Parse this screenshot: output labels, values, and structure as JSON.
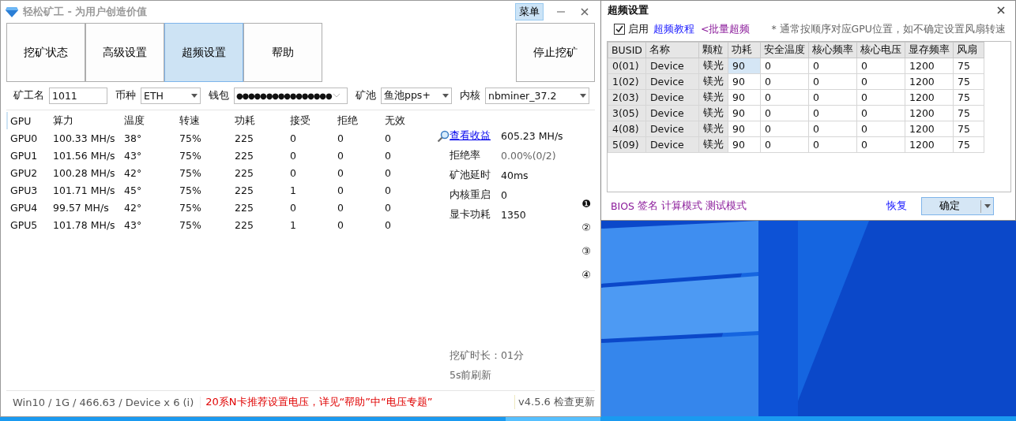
{
  "main_window": {
    "title": "轻松矿工 - 为用户创造价值",
    "menu_button": "菜单",
    "nav_tabs": [
      {
        "label": "挖矿状态",
        "selected": false
      },
      {
        "label": "高级设置",
        "selected": false
      },
      {
        "label": "超频设置",
        "selected": true
      },
      {
        "label": "帮助",
        "selected": false
      }
    ],
    "stop_button": "停止挖矿",
    "fields": [
      {
        "label": "矿工名",
        "value": "1011",
        "kind": "text"
      },
      {
        "label": "币种",
        "value": "ETH",
        "kind": "dropdown"
      },
      {
        "label": "钱包",
        "value": "●●●●●●●●●●●●●●●●",
        "kind": "password"
      },
      {
        "label": "矿池",
        "value": "鱼池pps+",
        "kind": "dropdown"
      },
      {
        "label": "内核",
        "value": "nbminer_37.2",
        "kind": "dropdown"
      }
    ],
    "gpu_table": {
      "columns": [
        "GPU",
        "算力",
        "温度",
        "转速",
        "功耗",
        "接受",
        "拒绝",
        "无效"
      ],
      "rows": [
        [
          "GPU0",
          "100.33 MH/s",
          "38°",
          "75%",
          "225",
          "0",
          "0",
          "0"
        ],
        [
          "GPU1",
          "101.56 MH/s",
          "43°",
          "75%",
          "225",
          "0",
          "0",
          "0"
        ],
        [
          "GPU2",
          "100.28 MH/s",
          "42°",
          "75%",
          "225",
          "0",
          "0",
          "0"
        ],
        [
          "GPU3",
          "101.71 MH/s",
          "45°",
          "75%",
          "225",
          "1",
          "0",
          "0"
        ],
        [
          "GPU4",
          "99.57 MH/s",
          "42°",
          "75%",
          "225",
          "0",
          "0",
          "0"
        ],
        [
          "GPU5",
          "101.78 MH/s",
          "43°",
          "75%",
          "225",
          "1",
          "0",
          "0"
        ]
      ]
    },
    "stats": [
      {
        "label": "查看收益",
        "value": "605.23 MH/s",
        "kind": "link"
      },
      {
        "label": "拒绝率",
        "value": "0.00%(0/2)",
        "kind": "muted"
      },
      {
        "label": "矿池延时",
        "value": "40ms",
        "kind": "plain"
      },
      {
        "label": "内核重启",
        "value": "0",
        "kind": "plain"
      },
      {
        "label": "显卡功耗",
        "value": "1350",
        "kind": "plain"
      }
    ],
    "pages": [
      "❶",
      "②",
      "③",
      "④"
    ],
    "runtime": {
      "label": "挖矿时长：",
      "value": "01分"
    },
    "refresh": "5s前刷新",
    "status_bar": {
      "system": "Win10  / 1G / 466.63 / Device x 6 (i)",
      "notice": "20系N卡推荐设置电压，详见“帮助”中“电压专题”",
      "version": "v4.5.6 检查更新"
    }
  },
  "overclock_window": {
    "title": "超频设置",
    "enable": {
      "label": "启用",
      "checked": true
    },
    "links": [
      {
        "label": "超频教程",
        "kind": "tutorial"
      },
      {
        "label": "<批量超频",
        "kind": "batch"
      }
    ],
    "note": "* 通常按顺序对应GPU位置，如不确定设置风扇转速",
    "table": {
      "columns": [
        "BUSID",
        "名称",
        "颗粒",
        "功耗",
        "安全温度",
        "核心频率",
        "核心电压",
        "显存频率",
        "风扇"
      ],
      "rows": [
        {
          "cells": [
            {
              "text": "0(01)",
              "selected": false
            },
            {
              "text": "Device",
              "selected": false
            },
            {
              "text": "镁光",
              "selected": false
            },
            {
              "text": "90",
              "selected": true
            },
            {
              "text": "0",
              "selected": false
            },
            {
              "text": "0",
              "selected": false
            },
            {
              "text": "0",
              "selected": false
            },
            {
              "text": "1200",
              "selected": false
            },
            {
              "text": "75",
              "selected": false
            }
          ]
        },
        {
          "cells": [
            {
              "text": "1(02)",
              "selected": false
            },
            {
              "text": "Device",
              "selected": false
            },
            {
              "text": "镁光",
              "selected": false
            },
            {
              "text": "90",
              "selected": false
            },
            {
              "text": "0",
              "selected": false
            },
            {
              "text": "0",
              "selected": false
            },
            {
              "text": "0",
              "selected": false
            },
            {
              "text": "1200",
              "selected": false
            },
            {
              "text": "75",
              "selected": false
            }
          ]
        },
        {
          "cells": [
            {
              "text": "2(03)",
              "selected": false
            },
            {
              "text": "Device",
              "selected": false
            },
            {
              "text": "镁光",
              "selected": false
            },
            {
              "text": "90",
              "selected": false
            },
            {
              "text": "0",
              "selected": false
            },
            {
              "text": "0",
              "selected": false
            },
            {
              "text": "0",
              "selected": false
            },
            {
              "text": "1200",
              "selected": false
            },
            {
              "text": "75",
              "selected": false
            }
          ]
        },
        {
          "cells": [
            {
              "text": "3(05)",
              "selected": false
            },
            {
              "text": "Device",
              "selected": false
            },
            {
              "text": "镁光",
              "selected": false
            },
            {
              "text": "90",
              "selected": false
            },
            {
              "text": "0",
              "selected": false
            },
            {
              "text": "0",
              "selected": false
            },
            {
              "text": "0",
              "selected": false
            },
            {
              "text": "1200",
              "selected": false
            },
            {
              "text": "75",
              "selected": false
            }
          ]
        },
        {
          "cells": [
            {
              "text": "4(08)",
              "selected": false
            },
            {
              "text": "Device",
              "selected": false
            },
            {
              "text": "镁光",
              "selected": false
            },
            {
              "text": "90",
              "selected": false
            },
            {
              "text": "0",
              "selected": false
            },
            {
              "text": "0",
              "selected": false
            },
            {
              "text": "0",
              "selected": false
            },
            {
              "text": "1200",
              "selected": false
            },
            {
              "text": "75",
              "selected": false
            }
          ]
        },
        {
          "cells": [
            {
              "text": "5(09)",
              "selected": false
            },
            {
              "text": "Device",
              "selected": false
            },
            {
              "text": "镁光",
              "selected": false
            },
            {
              "text": "90",
              "selected": false
            },
            {
              "text": "0",
              "selected": false
            },
            {
              "text": "0",
              "selected": false
            },
            {
              "text": "0",
              "selected": false
            },
            {
              "text": "1200",
              "selected": false
            },
            {
              "text": "75",
              "selected": false
            }
          ]
        }
      ]
    },
    "modes": [
      "BIOS",
      "签名",
      "计算模式",
      "测试模式"
    ],
    "restore_link": "恢复",
    "ok_button": "确定"
  }
}
